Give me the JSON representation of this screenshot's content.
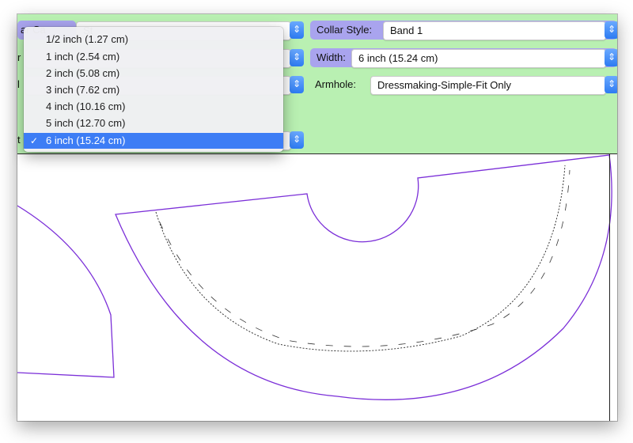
{
  "toolbar": {
    "partial_label_left": "ar Ca",
    "partial_value_left": "St",
    "collar_style_label": "Collar Style:",
    "collar_style_value": "Band 1",
    "width_label": "Width:",
    "width_value": "6 inch (15.24 cm)",
    "armhole_label": "Armhole:",
    "armhole_value": "Dressmaking-Simple-Fit Only",
    "row3_partial_label": "r",
    "row4_partial_label": "l",
    "row5_partial_label": "t"
  },
  "dropdown": {
    "options": [
      "1/2 inch (1.27 cm)",
      "1 inch (2.54 cm)",
      "2 inch (5.08 cm)",
      "3 inch (7.62 cm)",
      "4 inch (10.16 cm)",
      "5 inch (12.70 cm)",
      "6 inch (15.24 cm)"
    ],
    "selected": "6 inch (15.24 cm)",
    "checkmark": "✓"
  },
  "icons": {
    "stepper": "chevron-up-down-icon",
    "check": "checkmark-icon"
  },
  "colors": {
    "panel_green": "#b9f0b2",
    "label_purple": "#a9a4ee",
    "pattern_line": "#7b2fd8",
    "highlight_blue": "#3d7df5"
  }
}
